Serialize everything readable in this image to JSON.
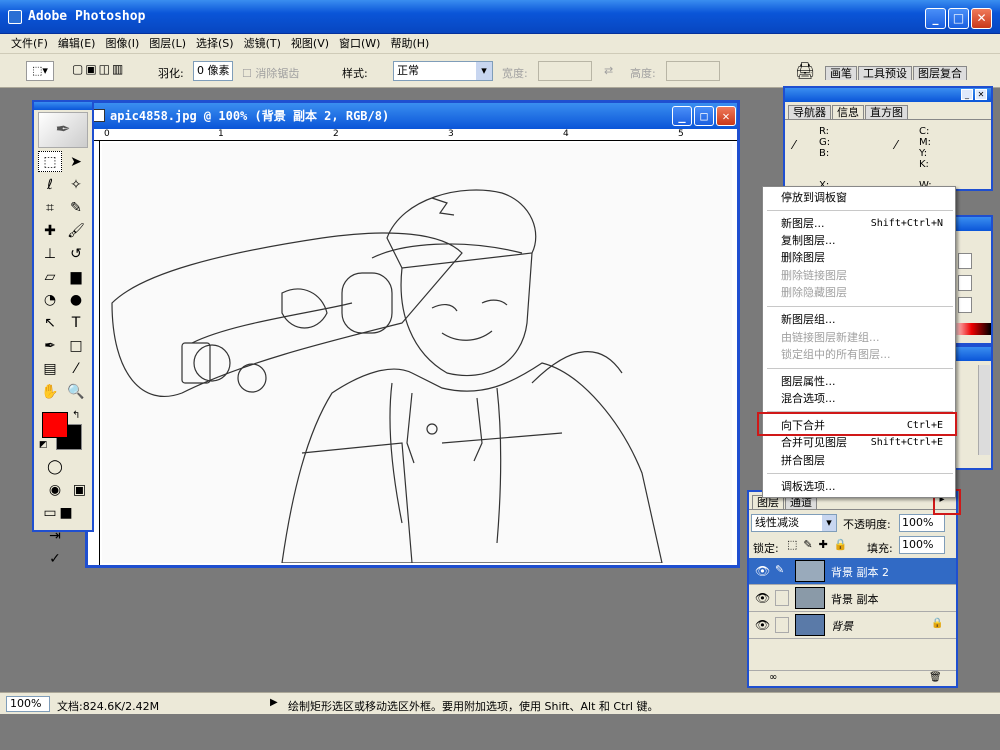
{
  "app": {
    "title": "Adobe Photoshop"
  },
  "menu": [
    "文件(F)",
    "编辑(E)",
    "图像(I)",
    "图层(L)",
    "选择(S)",
    "滤镜(T)",
    "视图(V)",
    "窗口(W)",
    "帮助(H)"
  ],
  "options": {
    "feather_label": "羽化:",
    "feather_value": "0 像素",
    "antialias_label": "消除锯齿",
    "style_label": "样式:",
    "style_value": "正常",
    "width_label": "宽度:",
    "height_label": "高度:",
    "well_tabs": [
      "画笔",
      "工具预设",
      "图层复合"
    ]
  },
  "document": {
    "title": "apic4858.jpg @ 100% (背景 副本 2, RGB/8)",
    "ruler_marks": [
      "0",
      "1",
      "2",
      "3",
      "4",
      "5"
    ]
  },
  "navigator": {
    "tabs": [
      "导航器",
      "信息",
      "直方图"
    ],
    "rgb_labels": "R: G: B:",
    "cmyk_labels": "C: M: Y: K:",
    "x_label": "X:",
    "w_label": "W:"
  },
  "context_menu": {
    "items": [
      {
        "label": "停放到调板窗",
        "shortcut": "",
        "disabled": false
      },
      {
        "label": "新图层...",
        "shortcut": "Shift+Ctrl+N",
        "disabled": false
      },
      {
        "label": "复制图层...",
        "shortcut": "",
        "disabled": false
      },
      {
        "label": "删除图层",
        "shortcut": "",
        "disabled": false
      },
      {
        "label": "删除链接图层",
        "shortcut": "",
        "disabled": true
      },
      {
        "label": "删除隐藏图层",
        "shortcut": "",
        "disabled": true
      },
      {
        "label": "新图层组...",
        "shortcut": "",
        "disabled": false
      },
      {
        "label": "由链接图层新建组...",
        "shortcut": "",
        "disabled": true
      },
      {
        "label": "锁定组中的所有图层...",
        "shortcut": "",
        "disabled": true
      },
      {
        "label": "图层属性...",
        "shortcut": "",
        "disabled": false
      },
      {
        "label": "混合选项...",
        "shortcut": "",
        "disabled": false
      },
      {
        "label": "向下合并",
        "shortcut": "Ctrl+E",
        "disabled": false
      },
      {
        "label": "合并可见图层",
        "shortcut": "Shift+Ctrl+E",
        "disabled": false
      },
      {
        "label": "拼合图层",
        "shortcut": "",
        "disabled": false
      },
      {
        "label": "调板选项...",
        "shortcut": "",
        "disabled": false
      }
    ]
  },
  "layers": {
    "tabs": [
      "图层",
      "通道"
    ],
    "blend_mode": "线性减淡",
    "opacity_label": "不透明度:",
    "opacity_value": "100%",
    "lock_label": "锁定:",
    "fill_label": "填充:",
    "fill_value": "100%",
    "rows": [
      {
        "name": "背景 副本 2",
        "selected": true
      },
      {
        "name": "背景 副本",
        "selected": false
      },
      {
        "name": "背景",
        "selected": false
      }
    ]
  },
  "status": {
    "zoom": "100%",
    "doc_info": "文档:824.6K/2.42M",
    "hint": "绘制矩形选区或移动选区外框。要用附加选项，使用 Shift、Alt 和 Ctrl 键。"
  },
  "colors": {
    "foreground": "#ff0000",
    "background": "#000000",
    "highlight": "#d01818"
  }
}
